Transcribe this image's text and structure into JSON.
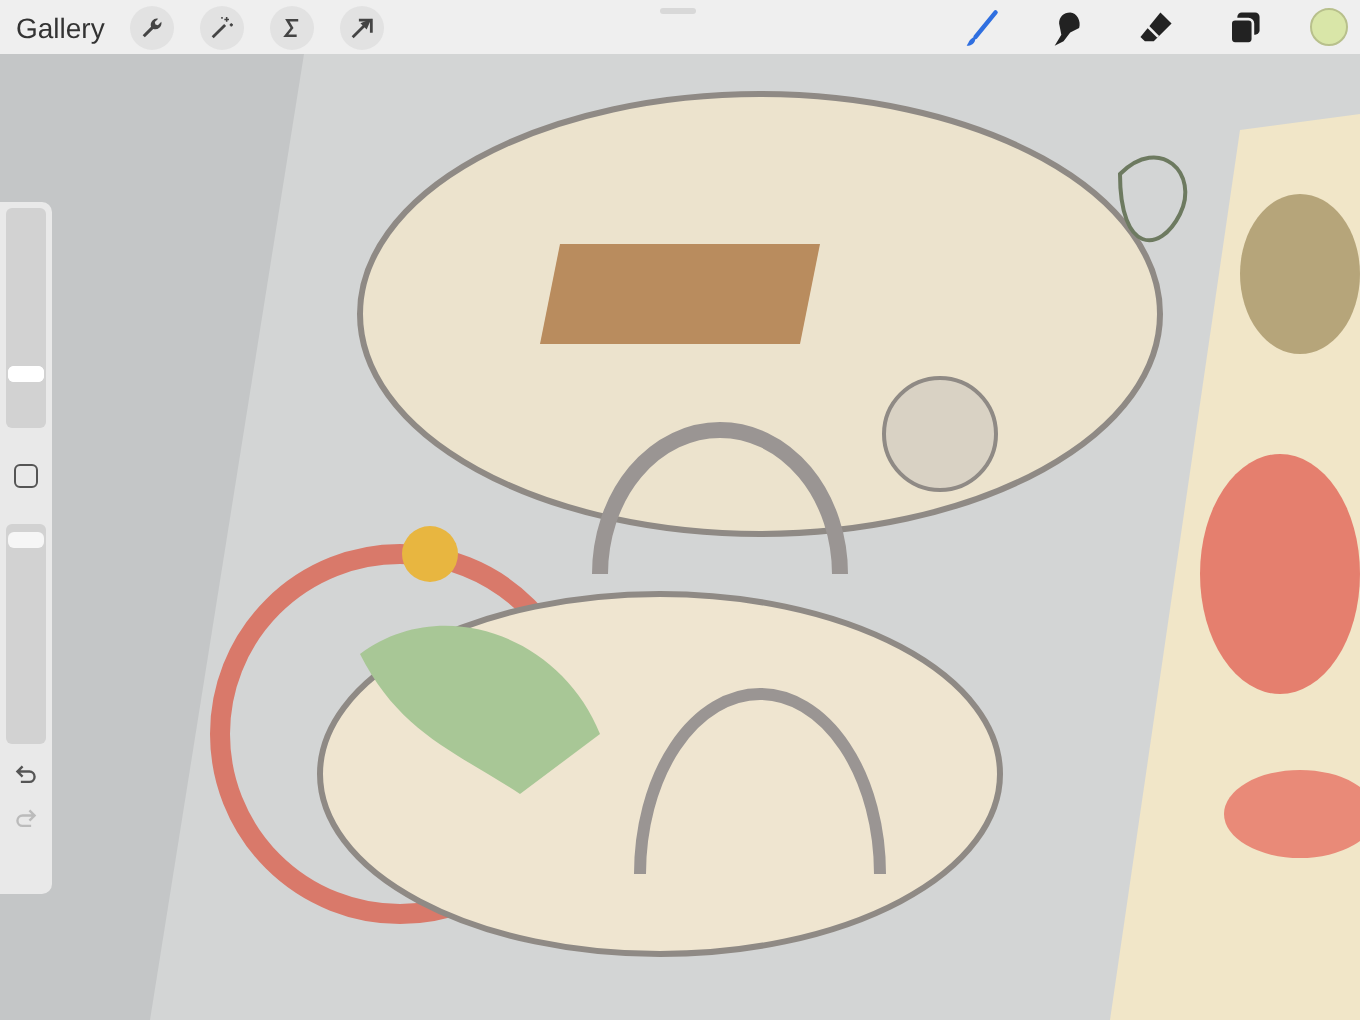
{
  "toolbar": {
    "gallery": "Gallery",
    "actions": [
      {
        "kind": "wrench"
      },
      {
        "kind": "wand"
      },
      {
        "kind": "selection"
      },
      {
        "kind": "transform"
      }
    ],
    "tools": [
      {
        "kind": "brush",
        "selected": true
      },
      {
        "kind": "smudge",
        "selected": false
      },
      {
        "kind": "eraser",
        "selected": false
      },
      {
        "kind": "layers",
        "selected": false
      }
    ],
    "color": {
      "color": "#d9e6a8"
    }
  },
  "sidebar": {
    "size_slider": {
      "level": 0.25
    },
    "opacity_slider": {
      "level": 0.93
    }
  }
}
